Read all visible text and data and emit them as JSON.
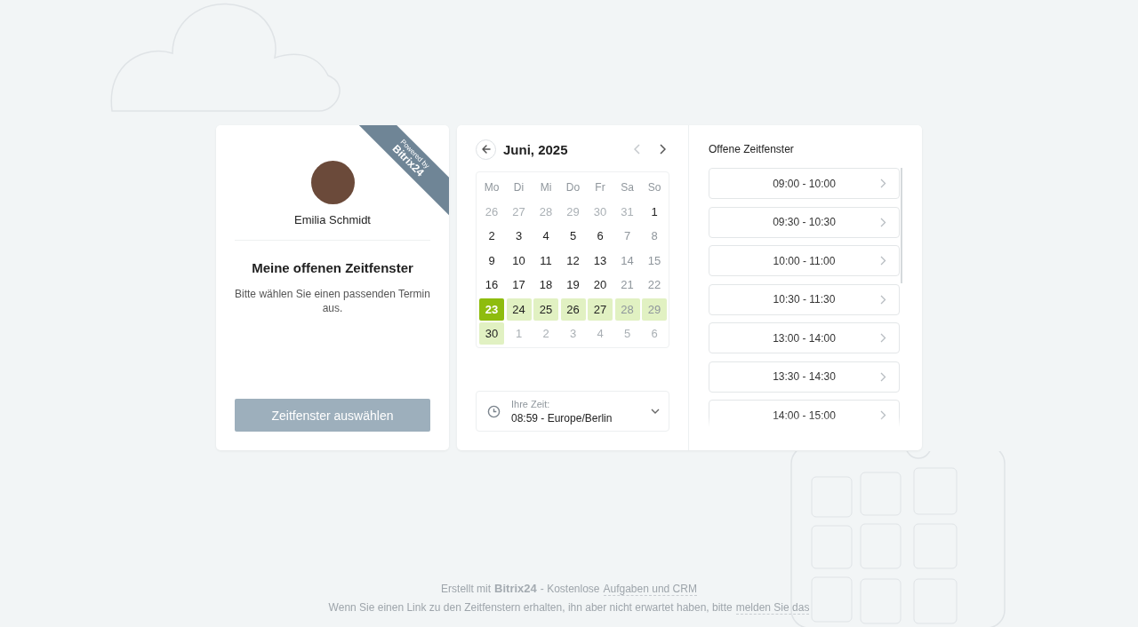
{
  "ribbon": {
    "line_1": "Powered by",
    "line_2": "Bitrix24"
  },
  "profile": {
    "name": "Emilia Schmidt"
  },
  "intro": {
    "title": "Meine offenen Zeitfenster",
    "text": "Bitte wählen Sie einen passenden Termin aus."
  },
  "select_button": {
    "label": "Zeitfenster auswählen",
    "disabled": true
  },
  "calendar": {
    "month": "Juni, 2025",
    "weekdays": [
      "Mo",
      "Di",
      "Mi",
      "Do",
      "Fr",
      "Sa",
      "So"
    ],
    "days": [
      {
        "text": "26",
        "kind": "outside"
      },
      {
        "text": "27",
        "kind": "outside"
      },
      {
        "text": "28",
        "kind": "outside"
      },
      {
        "text": "29",
        "kind": "outside"
      },
      {
        "text": "30",
        "kind": "outside"
      },
      {
        "text": "31",
        "kind": "outside"
      },
      {
        "text": "1",
        "kind": "day",
        "muted": false,
        "available": false,
        "selected": false
      },
      {
        "text": "2",
        "kind": "day",
        "muted": false,
        "available": false,
        "selected": false
      },
      {
        "text": "3",
        "kind": "day",
        "muted": false,
        "available": false,
        "selected": false
      },
      {
        "text": "4",
        "kind": "day",
        "muted": false,
        "available": false,
        "selected": false
      },
      {
        "text": "5",
        "kind": "day",
        "muted": false,
        "available": false,
        "selected": false
      },
      {
        "text": "6",
        "kind": "day",
        "muted": false,
        "available": false,
        "selected": false
      },
      {
        "text": "7",
        "kind": "day",
        "muted": true,
        "available": false,
        "selected": false
      },
      {
        "text": "8",
        "kind": "day",
        "muted": true,
        "available": false,
        "selected": false
      },
      {
        "text": "9",
        "kind": "day",
        "muted": false,
        "available": false,
        "selected": false
      },
      {
        "text": "10",
        "kind": "day",
        "muted": false,
        "available": false,
        "selected": false
      },
      {
        "text": "11",
        "kind": "day",
        "muted": false,
        "available": false,
        "selected": false
      },
      {
        "text": "12",
        "kind": "day",
        "muted": false,
        "available": false,
        "selected": false
      },
      {
        "text": "13",
        "kind": "day",
        "muted": false,
        "available": false,
        "selected": false
      },
      {
        "text": "14",
        "kind": "day",
        "muted": true,
        "available": false,
        "selected": false
      },
      {
        "text": "15",
        "kind": "day",
        "muted": true,
        "available": false,
        "selected": false
      },
      {
        "text": "16",
        "kind": "day",
        "muted": false,
        "available": false,
        "selected": false
      },
      {
        "text": "17",
        "kind": "day",
        "muted": false,
        "available": false,
        "selected": false
      },
      {
        "text": "18",
        "kind": "day",
        "muted": false,
        "available": false,
        "selected": false
      },
      {
        "text": "19",
        "kind": "day",
        "muted": false,
        "available": false,
        "selected": false
      },
      {
        "text": "20",
        "kind": "day",
        "muted": false,
        "available": false,
        "selected": false
      },
      {
        "text": "21",
        "kind": "day",
        "muted": true,
        "available": false,
        "selected": false
      },
      {
        "text": "22",
        "kind": "day",
        "muted": true,
        "available": false,
        "selected": false
      },
      {
        "text": "23",
        "kind": "day",
        "muted": false,
        "available": true,
        "selected": true
      },
      {
        "text": "24",
        "kind": "day",
        "muted": false,
        "available": true,
        "selected": false
      },
      {
        "text": "25",
        "kind": "day",
        "muted": false,
        "available": true,
        "selected": false
      },
      {
        "text": "26",
        "kind": "day",
        "muted": false,
        "available": true,
        "selected": false
      },
      {
        "text": "27",
        "kind": "day",
        "muted": false,
        "available": true,
        "selected": false
      },
      {
        "text": "28",
        "kind": "day",
        "muted": true,
        "available": true,
        "selected": false
      },
      {
        "text": "29",
        "kind": "day",
        "muted": true,
        "available": true,
        "selected": false
      },
      {
        "text": "30",
        "kind": "day",
        "muted": false,
        "available": true,
        "selected": false
      },
      {
        "text": "1",
        "kind": "outside"
      },
      {
        "text": "2",
        "kind": "outside"
      },
      {
        "text": "3",
        "kind": "outside"
      },
      {
        "text": "4",
        "kind": "outside"
      },
      {
        "text": "5",
        "kind": "outside"
      },
      {
        "text": "6",
        "kind": "outside"
      }
    ]
  },
  "timezone": {
    "label": "Ihre Zeit:",
    "value": "08:59 - Europe/Berlin"
  },
  "slots": {
    "title": "Offene Zeitfenster",
    "items": [
      "09:00 - 10:00",
      "09:30 - 10:30",
      "10:00 - 11:00",
      "10:30 - 11:30",
      "13:00 - 14:00",
      "13:30 - 14:30",
      "14:00 - 15:00"
    ]
  },
  "footer": {
    "prefix": "Erstellt mit",
    "brand": "Bitrix24",
    "middle": "- Kostenlose",
    "link": "Aufgaben und CRM",
    "notice": "Wenn Sie einen Link zu den Zeitfenstern erhalten, ihn aber nicht erwartet haben, bitte",
    "report_link": "melden Sie das"
  }
}
